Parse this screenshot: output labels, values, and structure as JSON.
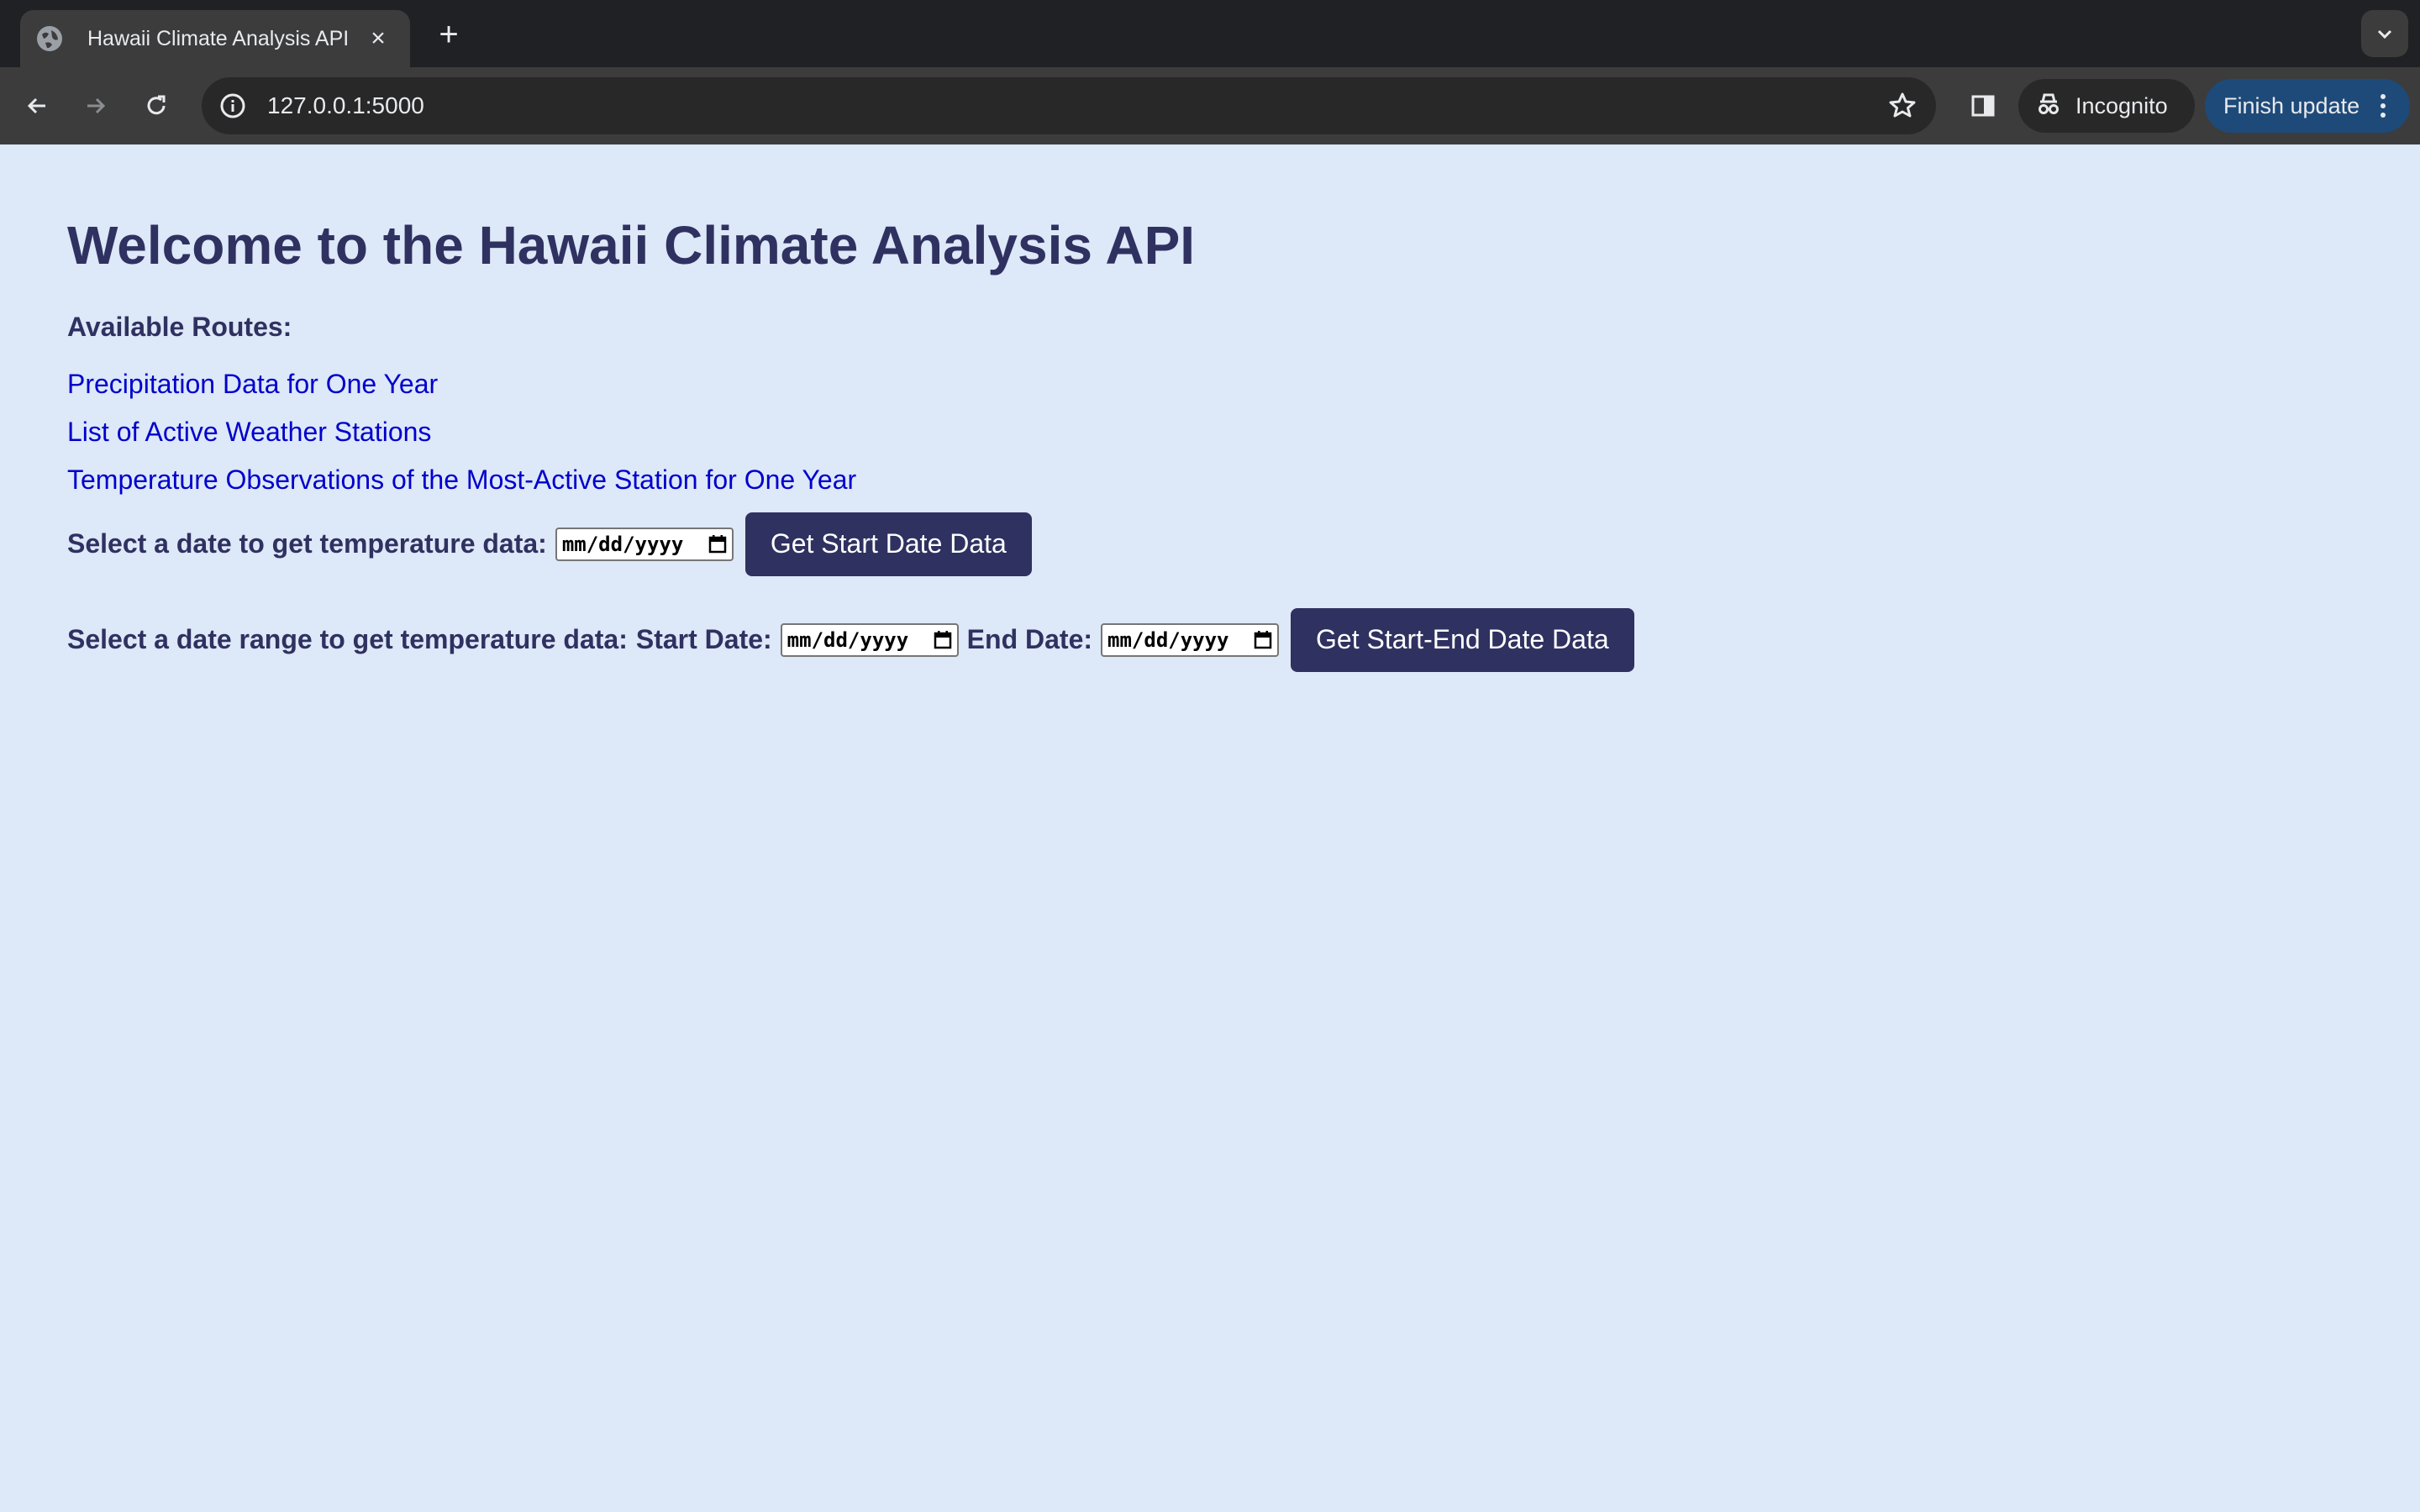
{
  "browser": {
    "tab_title": "Hawaii Climate Analysis API",
    "tab_close": "×",
    "new_tab": "+",
    "url": "127.0.0.1:5000",
    "incognito_label": "Incognito",
    "finish_update_label": "Finish update"
  },
  "page": {
    "title": "Welcome to the Hawaii Climate Analysis API",
    "routes_heading": "Available Routes:",
    "routes": [
      {
        "label": "Precipitation Data for One Year"
      },
      {
        "label": "List of Active Weather Stations"
      },
      {
        "label": "Temperature Observations of the Most-Active Station for One Year"
      }
    ],
    "start_form": {
      "label": "Select a date to get temperature data:",
      "date_placeholder": "mm/dd/yyyy",
      "button": "Get Start Date Data"
    },
    "range_form": {
      "label": "Select a date range to get temperature data:",
      "start_label": "Start Date:",
      "end_label": "End Date:",
      "date_placeholder": "mm/dd/yyyy",
      "button": "Get Start-End Date Data"
    }
  },
  "colors": {
    "page_bg": "#dde8f8",
    "heading": "#2f3160",
    "link": "#0000cc",
    "button_bg": "#2f3160"
  }
}
